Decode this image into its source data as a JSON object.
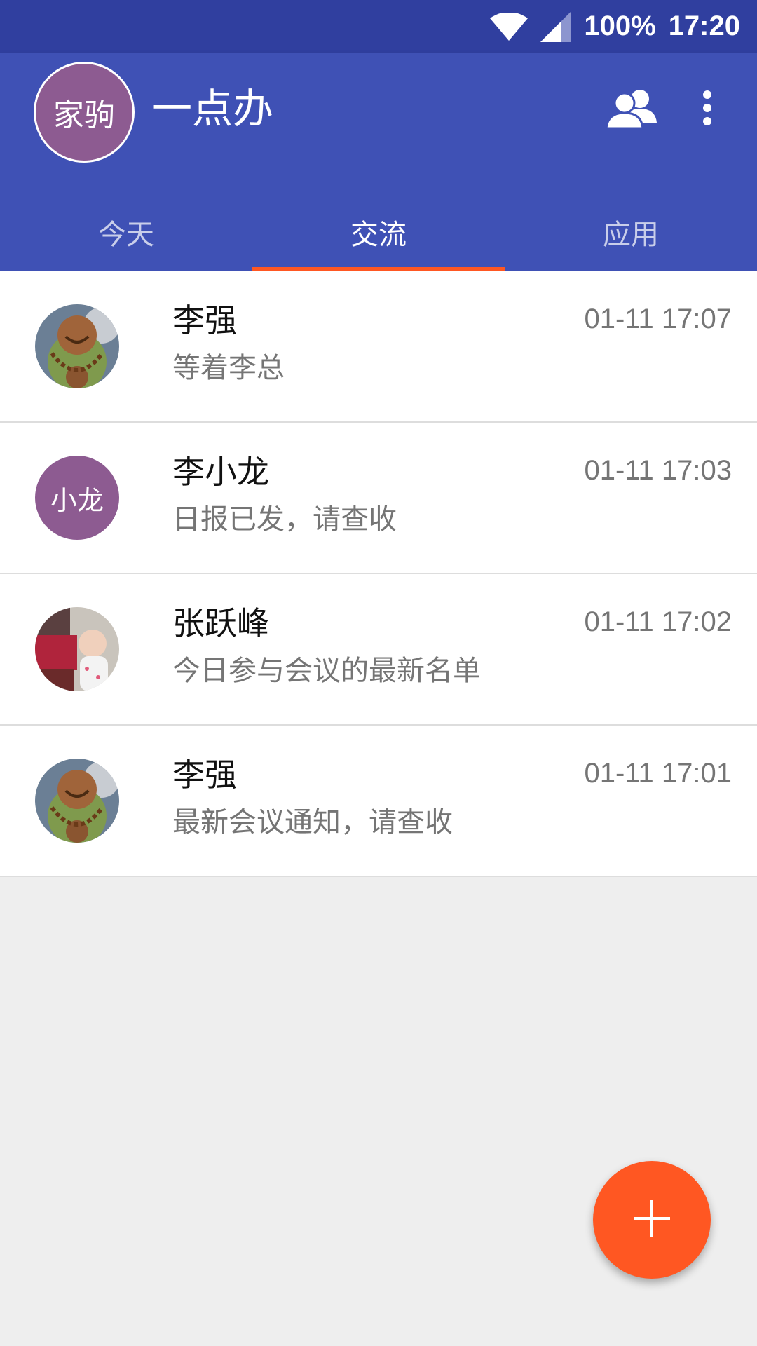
{
  "status_bar": {
    "battery": "100%",
    "time": "17:20",
    "wifi_icon": "wifi-icon",
    "signal_icon": "cell-signal-icon"
  },
  "app_bar": {
    "user_avatar_text": "家驹",
    "title": "一点办",
    "contacts_icon": "contacts-icon",
    "more_icon": "more-vert-icon",
    "color": "#3f51b5"
  },
  "tabs": [
    {
      "label": "今天",
      "active": false
    },
    {
      "label": "交流",
      "active": true
    },
    {
      "label": "应用",
      "active": false
    }
  ],
  "conversations": [
    {
      "name": "李强",
      "preview": "等着李总",
      "time": "01-11 17:07",
      "avatar": "buddha-photo"
    },
    {
      "name": "李小龙",
      "preview": "日报已发，请查收",
      "time": "01-11 17:03",
      "avatar_text": "小龙"
    },
    {
      "name": "张跃峰",
      "preview": "今日参与会议的最新名单",
      "time": "01-11 17:02",
      "avatar": "baby-photo"
    },
    {
      "name": "李强",
      "preview": "最新会议通知，请查收",
      "time": "01-11 17:01",
      "avatar": "buddha-photo"
    }
  ],
  "fab": {
    "icon": "plus-icon",
    "color": "#ff5722"
  },
  "colors": {
    "primary_dark": "#303f9f",
    "primary": "#3f51b5",
    "accent": "#ff5722",
    "avatar_purple": "#8d5b91"
  }
}
